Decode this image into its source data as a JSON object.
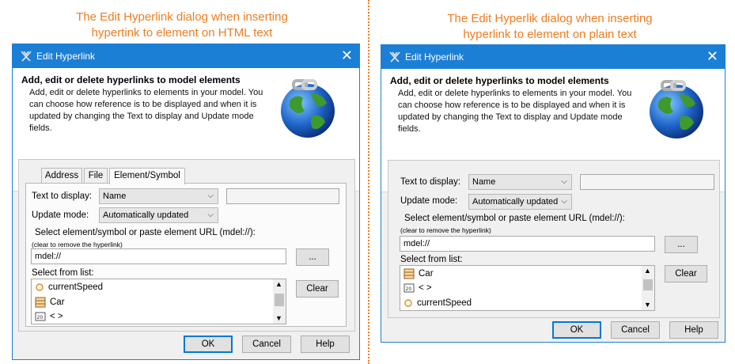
{
  "captions": {
    "left": "The Edit Hyperlink dialog when inserting\nhypertink to element on HTML text",
    "right": "The Edit Hyperlik dialog when inserting\nhyperlink to element on plain text"
  },
  "colors": {
    "caption": "#f07c1f",
    "titlebar": "#1c7fd6",
    "accent": "#0078d7"
  },
  "dialog_left": {
    "title": "Edit Hyperlink",
    "header_title": "Add, edit or delete hyperlinks to model elements",
    "header_desc": "Add, edit or delete hyperlinks to elements in your model. You can choose how reference is to be displayed and when it is updated by changing the Text to display and Update mode fields.",
    "tabs": [
      "Address",
      "File",
      "Element/Symbol"
    ],
    "text_to_display_label": "Text to display:",
    "text_to_display_value": "Name",
    "update_mode_label": "Update mode:",
    "update_mode_value": "Automatically updated",
    "select_label": "Select element/symbol or paste element URL (mdel://):",
    "clear_hint": "(clear to remove the hyperlink)",
    "url_value": "mdel://",
    "browse_label": "...",
    "select_list_label": "Select from list:",
    "list_items": [
      {
        "icon": "property-icon",
        "label": "currentSpeed"
      },
      {
        "icon": "class-icon",
        "label": "Car"
      },
      {
        "icon": "diagram-icon",
        "label": "< >"
      }
    ],
    "clear_label": "Clear",
    "ok_label": "OK",
    "cancel_label": "Cancel",
    "help_label": "Help"
  },
  "dialog_right": {
    "title": "Edit Hyperlink",
    "header_title": "Add, edit or delete hyperlinks to model elements",
    "header_desc": "Add, edit or delete hyperlinks to elements in your model. You can choose how reference is to be displayed and when it is updated by changing the Text to display and Update mode fields.",
    "text_to_display_label": "Text to display:",
    "text_to_display_value": "Name",
    "update_mode_label": "Update mode:",
    "update_mode_value": "Automatically updated",
    "select_label": "Select element/symbol or paste element URL (mdel://):",
    "clear_hint": "(clear to remove the hyperlink)",
    "url_value": "mdel://",
    "browse_label": "...",
    "select_list_label": "Select from list:",
    "list_items": [
      {
        "icon": "class-icon",
        "label": "Car"
      },
      {
        "icon": "diagram-icon",
        "label": "< >"
      },
      {
        "icon": "property-icon",
        "label": "currentSpeed"
      }
    ],
    "clear_label": "Clear",
    "ok_label": "OK",
    "cancel_label": "Cancel",
    "help_label": "Help"
  }
}
